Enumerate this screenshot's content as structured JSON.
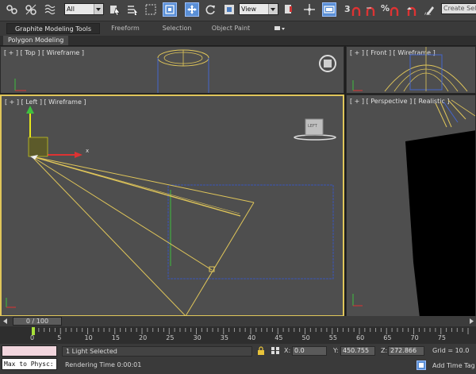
{
  "toolbar": {
    "filter_combo": "All",
    "reference_combo": "View",
    "snap_3": "3",
    "snap_percent": "%",
    "create_selection_placeholder": "Create Sel"
  },
  "ribbon": {
    "tabs": [
      "Graphite Modeling Tools",
      "Freeform",
      "Selection",
      "Object Paint"
    ],
    "active_tab": "Graphite Modeling Tools",
    "subtab": "Polygon Modeling"
  },
  "viewports": {
    "top": "[ + ] [ Top ] [ Wireframe ]",
    "front": "[ + ] [ Front ] [ Wireframe ]",
    "left": "[ + ] [ Left ] [ Wireframe ]",
    "perspective": "[ + ] [ Perspective ] [ Realistic ]",
    "viewcube_label": "LEFT",
    "gizmo_x": "x"
  },
  "timeline": {
    "frame": "0 / 100",
    "ticks": [
      "0",
      "5",
      "10",
      "15",
      "20",
      "25",
      "30",
      "35",
      "40",
      "45",
      "50",
      "55",
      "60",
      "65",
      "70",
      "75"
    ]
  },
  "status": {
    "script_listener": "Max to Physc:",
    "selection": "1 Light Selected",
    "rendering_time": "Rendering Time  0:00:01",
    "x_label": "X:",
    "x_value": "0.0",
    "y_label": "Y:",
    "y_value": "450.755",
    "z_label": "Z:",
    "z_value": "272.866",
    "grid": "Grid = 10.0",
    "add_time_tag": "Add Time Tag"
  },
  "colors": {
    "active_border": "#e0c65a",
    "selection_blue": "#5a8fd6",
    "light_yellow": "#e0c65a",
    "viewport_bg": "#4e4e4e"
  }
}
